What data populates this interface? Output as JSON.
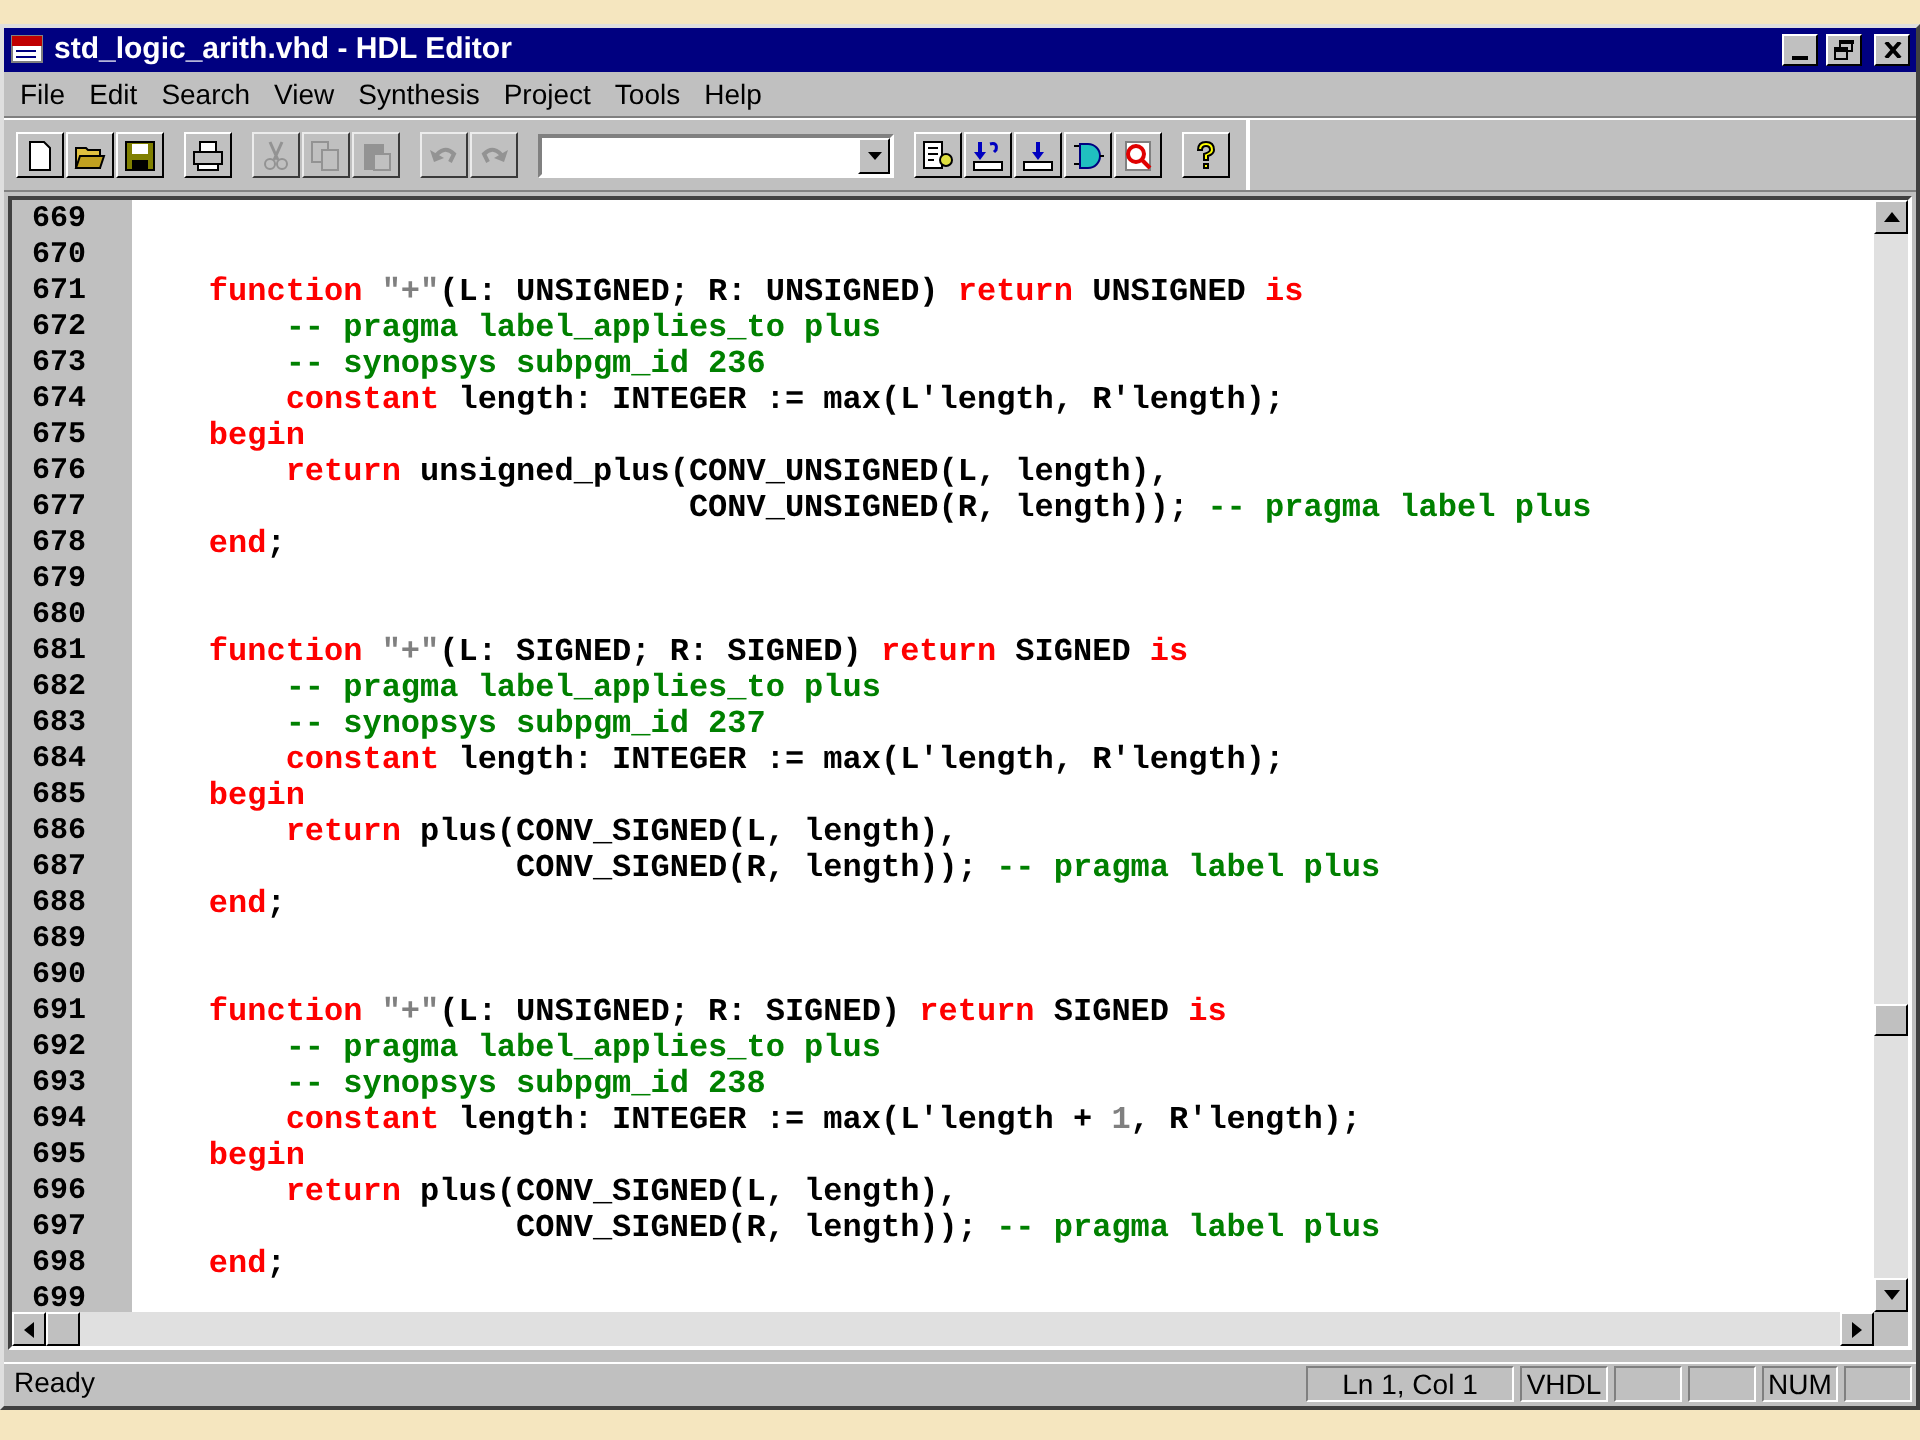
{
  "window": {
    "title": "std_logic_arith.vhd - HDL Editor"
  },
  "menu": [
    "File",
    "Edit",
    "Search",
    "View",
    "Synthesis",
    "Project",
    "Tools",
    "Help"
  ],
  "toolbar": [
    {
      "kind": "buttons",
      "buttons": [
        {
          "kind": "new",
          "disabled": false
        },
        {
          "kind": "open",
          "disabled": false
        },
        {
          "kind": "save",
          "disabled": false
        }
      ]
    },
    {
      "kind": "buttons",
      "buttons": [
        {
          "kind": "print",
          "disabled": false
        }
      ]
    },
    {
      "kind": "buttons",
      "buttons": [
        {
          "kind": "cut",
          "disabled": true
        },
        {
          "kind": "copy",
          "disabled": true
        },
        {
          "kind": "paste",
          "disabled": true
        }
      ]
    },
    {
      "kind": "buttons",
      "buttons": [
        {
          "kind": "undo",
          "disabled": true
        },
        {
          "kind": "redo",
          "disabled": true
        }
      ]
    },
    {
      "kind": "combo"
    },
    {
      "kind": "buttons",
      "buttons": [
        {
          "kind": "check",
          "disabled": false
        },
        {
          "kind": "query",
          "disabled": false
        },
        {
          "kind": "load",
          "disabled": false
        },
        {
          "kind": "gate",
          "disabled": false
        },
        {
          "kind": "zoom",
          "disabled": false
        }
      ]
    },
    {
      "kind": "buttons",
      "buttons": [
        {
          "kind": "help",
          "disabled": false
        }
      ]
    }
  ],
  "editor": {
    "lines": [
      {
        "number": "669"
      },
      {
        "number": "670"
      },
      {
        "number": "671",
        "tokens": [
          {
            "kind": "keyword",
            "text": "    function"
          },
          {
            "kind": "literal",
            "text": " \"+\""
          },
          {
            "kind": "plain",
            "text": "(L: UNSIGNED; R: UNSIGNED) "
          },
          {
            "kind": "keyword",
            "text": "return"
          },
          {
            "kind": "plain",
            "text": " UNSIGNED "
          },
          {
            "kind": "keyword",
            "text": "is"
          }
        ]
      },
      {
        "number": "672",
        "tokens": [
          {
            "kind": "comment",
            "text": "        -- pragma label_applies_to plus"
          }
        ]
      },
      {
        "number": "673",
        "tokens": [
          {
            "kind": "comment",
            "text": "        -- synopsys subpgm_id 236"
          }
        ]
      },
      {
        "number": "674",
        "tokens": [
          {
            "kind": "keyword",
            "text": "        constant"
          },
          {
            "kind": "plain",
            "text": " length: INTEGER := max(L'length, R'length);"
          }
        ]
      },
      {
        "number": "675",
        "tokens": [
          {
            "kind": "keyword",
            "text": "    begin"
          }
        ]
      },
      {
        "number": "676",
        "tokens": [
          {
            "kind": "keyword",
            "text": "        return"
          },
          {
            "kind": "plain",
            "text": " unsigned_plus(CONV_UNSIGNED(L, length),"
          }
        ]
      },
      {
        "number": "677",
        "tokens": [
          {
            "kind": "plain",
            "text": "                             CONV_UNSIGNED(R, length)); "
          },
          {
            "kind": "comment",
            "text": "-- pragma label plus"
          }
        ]
      },
      {
        "number": "678",
        "tokens": [
          {
            "kind": "keyword",
            "text": "    end"
          },
          {
            "kind": "plain",
            "text": ";"
          }
        ]
      },
      {
        "number": "679"
      },
      {
        "number": "680"
      },
      {
        "number": "681",
        "tokens": [
          {
            "kind": "keyword",
            "text": "    function"
          },
          {
            "kind": "literal",
            "text": " \"+\""
          },
          {
            "kind": "plain",
            "text": "(L: SIGNED; R: SIGNED) "
          },
          {
            "kind": "keyword",
            "text": "return"
          },
          {
            "kind": "plain",
            "text": " SIGNED "
          },
          {
            "kind": "keyword",
            "text": "is"
          }
        ]
      },
      {
        "number": "682",
        "tokens": [
          {
            "kind": "comment",
            "text": "        -- pragma label_applies_to plus"
          }
        ]
      },
      {
        "number": "683",
        "tokens": [
          {
            "kind": "comment",
            "text": "        -- synopsys subpgm_id 237"
          }
        ]
      },
      {
        "number": "684",
        "tokens": [
          {
            "kind": "keyword",
            "text": "        constant"
          },
          {
            "kind": "plain",
            "text": " length: INTEGER := max(L'length, R'length);"
          }
        ]
      },
      {
        "number": "685",
        "tokens": [
          {
            "kind": "keyword",
            "text": "    begin"
          }
        ]
      },
      {
        "number": "686",
        "tokens": [
          {
            "kind": "keyword",
            "text": "        return"
          },
          {
            "kind": "plain",
            "text": " plus(CONV_SIGNED(L, length),"
          }
        ]
      },
      {
        "number": "687",
        "tokens": [
          {
            "kind": "plain",
            "text": "                    CONV_SIGNED(R, length)); "
          },
          {
            "kind": "comment",
            "text": "-- pragma label plus"
          }
        ]
      },
      {
        "number": "688",
        "tokens": [
          {
            "kind": "keyword",
            "text": "    end"
          },
          {
            "kind": "plain",
            "text": ";"
          }
        ]
      },
      {
        "number": "689"
      },
      {
        "number": "690"
      },
      {
        "number": "691",
        "tokens": [
          {
            "kind": "keyword",
            "text": "    function"
          },
          {
            "kind": "literal",
            "text": " \"+\""
          },
          {
            "kind": "plain",
            "text": "(L: UNSIGNED; R: SIGNED) "
          },
          {
            "kind": "keyword",
            "text": "return"
          },
          {
            "kind": "plain",
            "text": " SIGNED "
          },
          {
            "kind": "keyword",
            "text": "is"
          }
        ]
      },
      {
        "number": "692",
        "tokens": [
          {
            "kind": "comment",
            "text": "        -- pragma label_applies_to plus"
          }
        ]
      },
      {
        "number": "693",
        "tokens": [
          {
            "kind": "comment",
            "text": "        -- synopsys subpgm_id 238"
          }
        ]
      },
      {
        "number": "694",
        "tokens": [
          {
            "kind": "keyword",
            "text": "        constant"
          },
          {
            "kind": "plain",
            "text": " length: INTEGER := max(L'length + "
          },
          {
            "kind": "literal",
            "text": "1"
          },
          {
            "kind": "plain",
            "text": ", R'length);"
          }
        ]
      },
      {
        "number": "695",
        "tokens": [
          {
            "kind": "keyword",
            "text": "    begin"
          }
        ]
      },
      {
        "number": "696",
        "tokens": [
          {
            "kind": "keyword",
            "text": "        return"
          },
          {
            "kind": "plain",
            "text": " plus(CONV_SIGNED(L, length),"
          }
        ]
      },
      {
        "number": "697",
        "tokens": [
          {
            "kind": "plain",
            "text": "                    CONV_SIGNED(R, length)); "
          },
          {
            "kind": "comment",
            "text": "-- pragma label plus"
          }
        ]
      },
      {
        "number": "698",
        "tokens": [
          {
            "kind": "keyword",
            "text": "    end"
          },
          {
            "kind": "plain",
            "text": ";"
          }
        ]
      },
      {
        "number": "699"
      }
    ]
  },
  "status_bar": {
    "message": "Ready",
    "panels": [
      {
        "kind": "text",
        "text": "Ln 1, Col 1"
      },
      {
        "kind": "text",
        "text": "VHDL"
      },
      {
        "kind": "blank"
      },
      {
        "kind": "blank"
      },
      {
        "kind": "text",
        "text": "NUM"
      },
      {
        "kind": "blank"
      }
    ]
  }
}
